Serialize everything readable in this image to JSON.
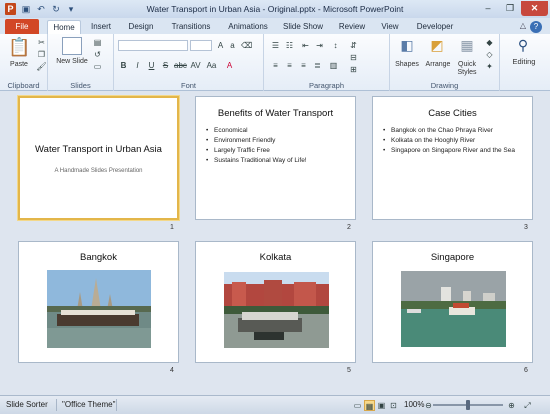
{
  "window": {
    "title": "Water Transport in Urban Asia - Original.pptx - Microsoft PowerPoint",
    "app_icon": "P"
  },
  "quick_access": [
    "save-icon",
    "undo-icon",
    "redo-icon",
    "customize-icon"
  ],
  "tabs": [
    "File",
    "Home",
    "Insert",
    "Design",
    "Transitions",
    "Animations",
    "Slide Show",
    "Review",
    "View",
    "Developer"
  ],
  "active_tab": "Home",
  "ribbon": {
    "clipboard": {
      "label": "Clipboard",
      "paste": "Paste"
    },
    "slides": {
      "label": "Slides",
      "new_slide": "New Slide"
    },
    "font": {
      "label": "Font"
    },
    "paragraph": {
      "label": "Paragraph"
    },
    "drawing": {
      "label": "Drawing",
      "shapes": "Shapes",
      "arrange": "Arrange",
      "quick_styles": "Quick Styles"
    },
    "editing": {
      "label": "Editing"
    }
  },
  "slides": [
    {
      "num": "1",
      "title": "Water Transport in Urban Asia",
      "subtitle": "A Handmade Slides Presentation"
    },
    {
      "num": "2",
      "title": "Benefits of Water Transport",
      "bullets": [
        "Economical",
        "Environment Friendly",
        "Largely Traffic Free",
        "Sustains Traditional Way of Life!"
      ]
    },
    {
      "num": "3",
      "title": "Case Cities",
      "bullets": [
        "Bangkok on the Chao Phraya River",
        "Kolkata on the Hooghly River",
        "Singapore on Singapore River and the Sea"
      ]
    },
    {
      "num": "4",
      "title": "Bangkok"
    },
    {
      "num": "5",
      "title": "Kolkata"
    },
    {
      "num": "6",
      "title": "Singapore"
    }
  ],
  "status": {
    "view": "Slide Sorter",
    "theme": "\"Office Theme\"",
    "zoom": "100%",
    "zoom_level": 0.5
  },
  "colors": {
    "file_tab": "#d24726",
    "selection": "#e3b64a"
  }
}
